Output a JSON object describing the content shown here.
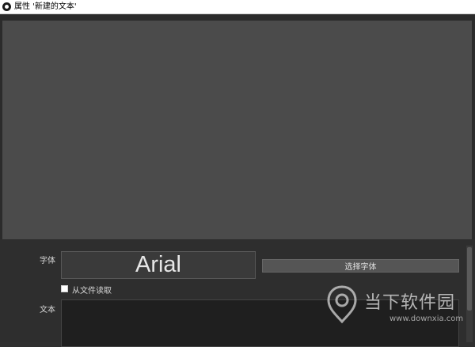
{
  "window": {
    "title": "属性 '新建的文本'"
  },
  "properties": {
    "font_label": "字体",
    "font_preview": "Arial",
    "select_font_button": "选择字体",
    "read_from_file_label": "从文件读取",
    "read_from_file_checked": false,
    "text_label": "文本",
    "text_value": ""
  },
  "watermark": {
    "name": "当下软件园",
    "url": "www.downxia.com"
  },
  "colors": {
    "preview_background": "#4b4b4b",
    "panel_background": "#2e2e2e",
    "button_background": "#555555"
  }
}
